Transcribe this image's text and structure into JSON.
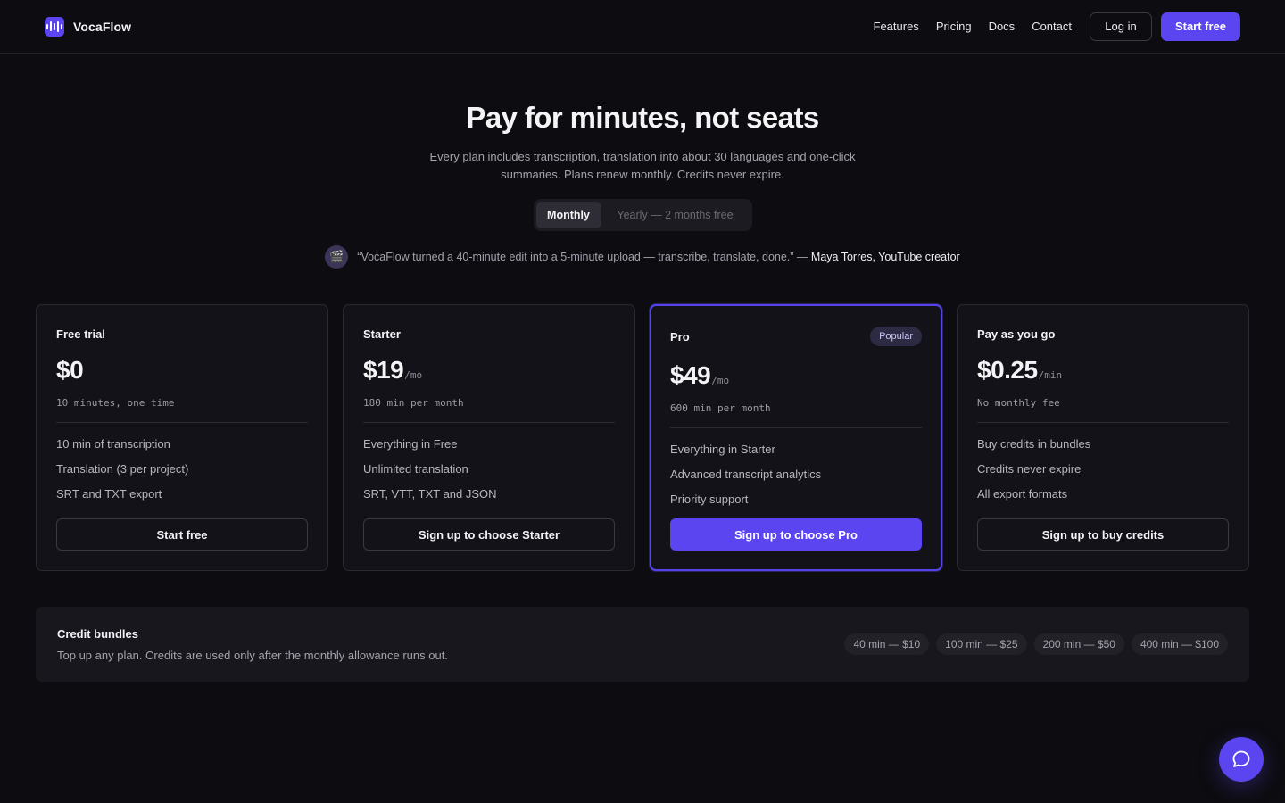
{
  "brand": {
    "name": "VocaFlow",
    "accent": "#5b45f0",
    "logo_icon": "audio-wave-icon"
  },
  "nav": {
    "links": [
      "Features",
      "Pricing",
      "Docs",
      "Contact"
    ],
    "login_label": "Log in",
    "start_label": "Start free"
  },
  "hero": {
    "title": "Pay for minutes, not seats",
    "subtitle": "Every plan includes transcription, translation into about 30 languages and one-click summaries. Plans renew monthly. Credits never expire.",
    "billing_toggle": {
      "options": [
        "Monthly",
        "Yearly — 2 months free"
      ],
      "selected": "Monthly"
    },
    "quote": {
      "avatar_icon": "clapper-board-icon",
      "avatar_glyph": "🎬",
      "text": "“VocaFlow turned a 40-minute edit into a 5-minute upload — transcribe, translate, done.” —",
      "author": "Maya Torres, YouTube creator"
    }
  },
  "plans": [
    {
      "name": "Free trial",
      "price": "$0",
      "unit": "",
      "allowance": "10 minutes, one time",
      "features": [
        "10 min of transcription",
        "Translation (3 per project)",
        "SRT and TXT export"
      ],
      "cta": "Start free",
      "popular": false
    },
    {
      "name": "Starter",
      "price": "$19",
      "unit": "/mo",
      "allowance": "180 min per month",
      "features": [
        "Everything in Free",
        "Unlimited translation",
        "SRT, VTT, TXT and JSON"
      ],
      "cta": "Sign up to choose Starter",
      "popular": false
    },
    {
      "name": "Pro",
      "price": "$49",
      "unit": "/mo",
      "badge": "Popular",
      "allowance": "600 min per month",
      "features": [
        "Everything in Starter",
        "Advanced transcript analytics",
        "Priority support"
      ],
      "cta": "Sign up to choose Pro",
      "popular": true
    },
    {
      "name": "Pay as you go",
      "price": "$0.25",
      "unit": "/min",
      "allowance": "No monthly fee",
      "features": [
        "Buy credits in bundles",
        "Credits never expire",
        "All export formats"
      ],
      "cta": "Sign up to buy credits",
      "popular": false
    }
  ],
  "bundles": {
    "title": "Credit bundles",
    "description": "Top up any plan. Credits are used only after the monthly allowance runs out.",
    "options": [
      "40 min — $10",
      "100 min — $25",
      "200 min — $50",
      "400 min — $100"
    ]
  },
  "chat": {
    "icon": "chat-bubble-icon"
  }
}
